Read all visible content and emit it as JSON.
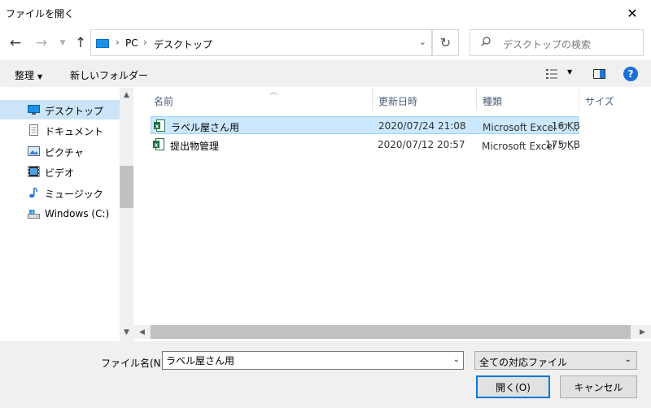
{
  "window": {
    "title": "ファイルを開く"
  },
  "address": {
    "segments": [
      "PC",
      "デスクトップ"
    ]
  },
  "search": {
    "placeholder": "デスクトップの検索"
  },
  "toolbar": {
    "organize": "整理",
    "new_folder": "新しいフォルダー"
  },
  "nav": {
    "items": [
      {
        "label": "デスクトップ",
        "icon": "desktop-icon",
        "selected": true
      },
      {
        "label": "ドキュメント",
        "icon": "documents-icon"
      },
      {
        "label": "ピクチャ",
        "icon": "pictures-icon"
      },
      {
        "label": "ビデオ",
        "icon": "videos-icon"
      },
      {
        "label": "ミュージック",
        "icon": "music-icon"
      },
      {
        "label": "Windows (C:)",
        "icon": "drive-icon"
      }
    ]
  },
  "columns": {
    "name": "名前",
    "date": "更新日時",
    "type": "種類",
    "size": "サイズ"
  },
  "files": [
    {
      "name": "ラベル屋さん用",
      "date": "2020/07/24 21:08",
      "type": "Microsoft Excel ワ...",
      "size": "16 KB",
      "selected": true
    },
    {
      "name": "提出物管理",
      "date": "2020/07/12 20:57",
      "type": "Microsoft Excel ワ...",
      "size": "175 KB"
    }
  ],
  "bottom": {
    "filename_label": "ファイル名(N):",
    "filename_value": "ラベル屋さん用",
    "filetype": "全ての対応ファイル",
    "open": "開く(O)",
    "cancel": "キャンセル"
  },
  "colors": {
    "selection": "#cce8ff",
    "nav_selection": "#cce4f7",
    "accent": "#0078d7",
    "excel": "#217346"
  }
}
